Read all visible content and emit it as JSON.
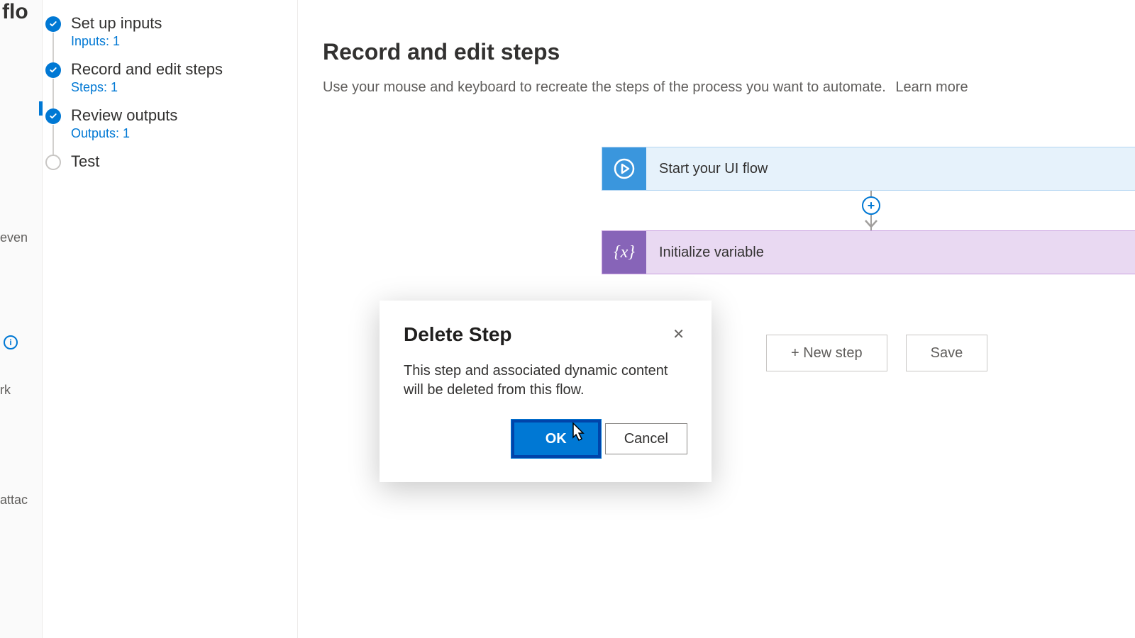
{
  "leftRail": {
    "title_fragment": "a flo",
    "items": [
      "even",
      "rk",
      "attac"
    ]
  },
  "stepper": [
    {
      "label": "Set up inputs",
      "sub": "Inputs: 1",
      "status": "done"
    },
    {
      "label": "Record and edit steps",
      "sub": "Steps: 1",
      "status": "done"
    },
    {
      "label": "Review outputs",
      "sub": "Outputs: 1",
      "status": "done"
    },
    {
      "label": "Test",
      "sub": "",
      "status": "todo"
    }
  ],
  "main": {
    "title": "Record and edit steps",
    "description": "Use your mouse and keyboard to recreate the steps of the process you want to automate.",
    "learn_more": "Learn more"
  },
  "flow": {
    "card1": "Start your UI flow",
    "card2": "Initialize variable",
    "plus": "+"
  },
  "actions": {
    "new_step": "+ New step",
    "save": "Save"
  },
  "dialog": {
    "title": "Delete Step",
    "body": "This step and associated dynamic content will be deleted from this flow.",
    "ok": "OK",
    "cancel": "Cancel",
    "close": "✕"
  }
}
